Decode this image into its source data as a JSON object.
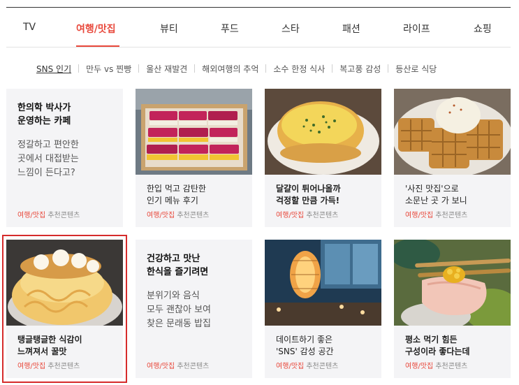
{
  "tabs": [
    {
      "label": "TV"
    },
    {
      "label": "여행/맛집",
      "active": true
    },
    {
      "label": "뷰티"
    },
    {
      "label": "푸드"
    },
    {
      "label": "스타"
    },
    {
      "label": "패션"
    },
    {
      "label": "라이프"
    },
    {
      "label": "쇼핑"
    }
  ],
  "subnav": [
    {
      "label": "SNS 인기",
      "active": true
    },
    {
      "label": "만두 vs 찐빵"
    },
    {
      "label": "울산 재발견"
    },
    {
      "label": "해외여행의 추억"
    },
    {
      "label": "소수 한정 식사"
    },
    {
      "label": "복고풍 감성"
    },
    {
      "label": "등산로 식당"
    }
  ],
  "cards": [
    {
      "type": "text",
      "title": "한의학 박사가\n운영하는 카페",
      "desc": "정갈하고 편안한\n곳에서 대접받는\n느낌이 든다고?",
      "category": "여행/맛집",
      "source": "추천콘텐츠"
    },
    {
      "type": "image",
      "image": "bento-sandwich-box",
      "caption": "한입 먹고 감탄한\n인기 메뉴 후기",
      "category": "여행/맛집",
      "source": "추천콘텐츠"
    },
    {
      "type": "image",
      "image": "egg-toast-bun",
      "caption": "달걀이 튀어나올까\n걱정할 만큼 가득!",
      "category": "여행/맛집",
      "source": "추천콘텐츠"
    },
    {
      "type": "image",
      "image": "waffle-ice-cream",
      "caption": "'사진 맛집'으로\n소문난 곳 가 보니",
      "category": "여행/맛집",
      "source": "추천콘텐츠"
    },
    {
      "type": "image",
      "image": "cream-dessert-bowl",
      "caption": "탱글탱글한 식감이\n느껴져서 꿀맛",
      "category": "여행/맛집",
      "source": "추천콘텐츠",
      "highlighted": true
    },
    {
      "type": "text",
      "title": "건강하고 맛난\n한식을 즐기려면",
      "desc": "분위기와 음식\n모두 괜찮아 보여\n찾은 문래동 밥집",
      "category": "여행/맛집",
      "source": "추천콘텐츠"
    },
    {
      "type": "image",
      "image": "cafe-lamp-interior",
      "caption": "데이트하기 좋은\n'SNS' 감성 공간",
      "category": "여행/맛집",
      "source": "추천콘텐츠"
    },
    {
      "type": "image",
      "image": "sashimi-chopsticks",
      "caption": "평소 먹기 힘든\n구성이라 좋다는데",
      "category": "여행/맛집",
      "source": "추천콘텐츠"
    }
  ],
  "colors": {
    "accent": "#e8483b",
    "highlight_border": "#d62b2b",
    "card_bg": "#f4f4f6"
  }
}
